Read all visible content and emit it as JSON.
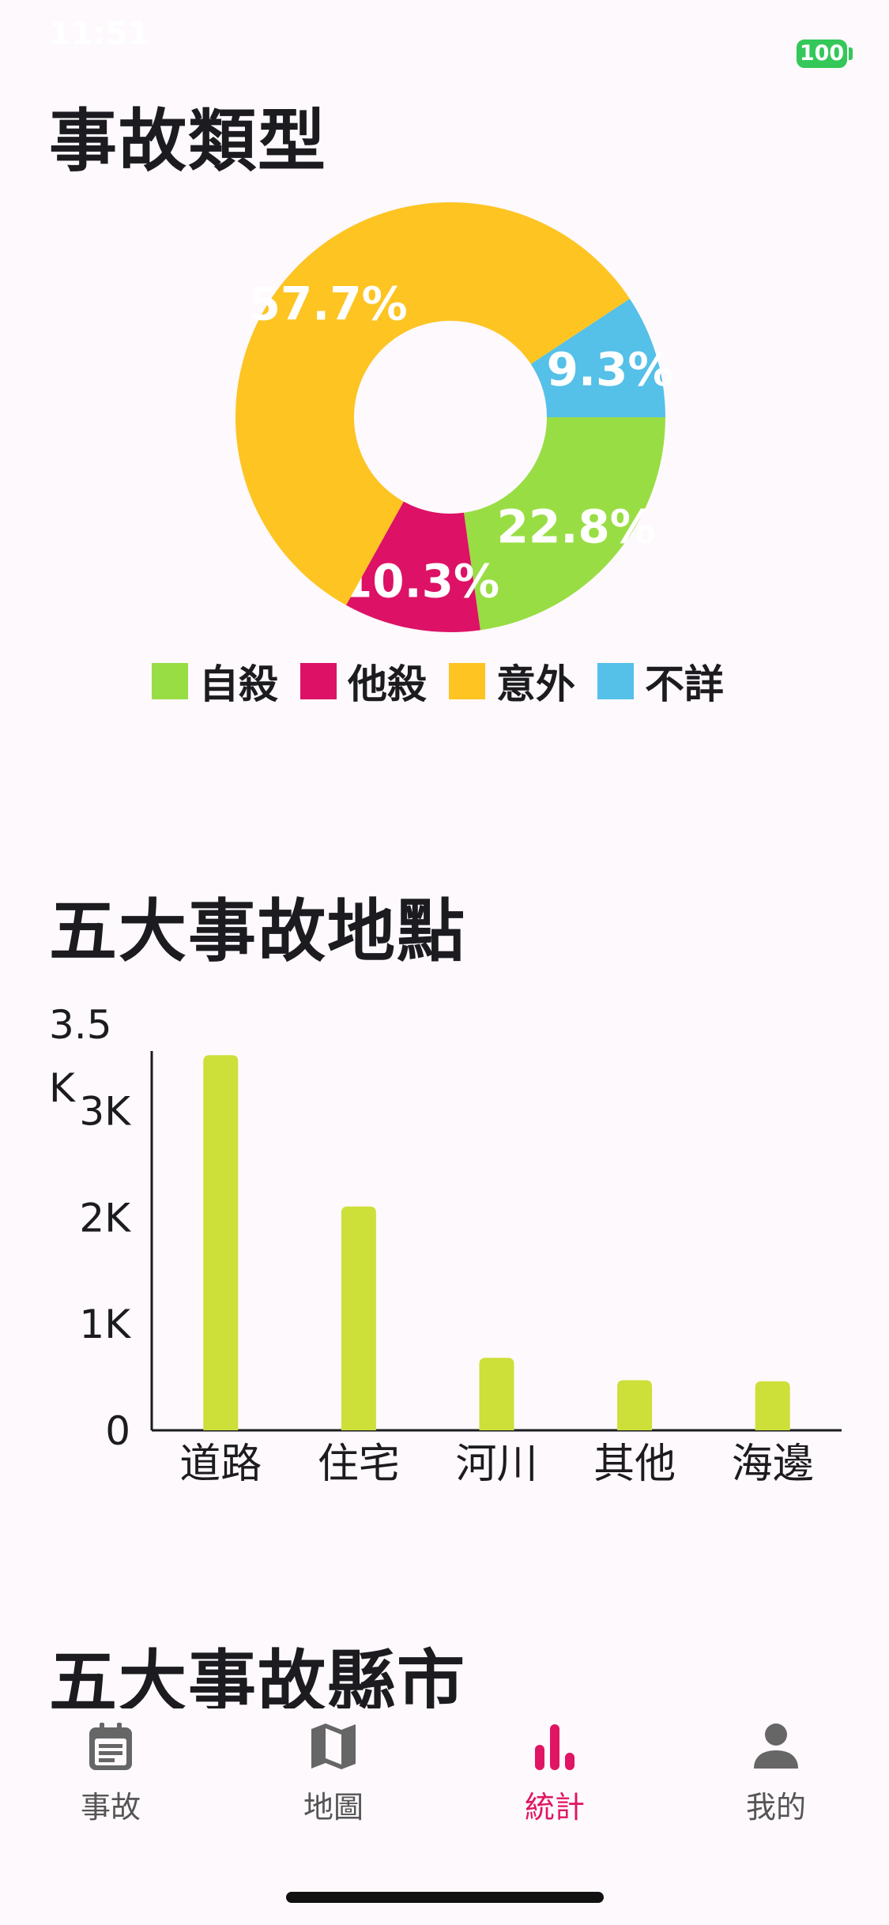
{
  "status_bar": {
    "time": "11:51",
    "battery": "100"
  },
  "sections": {
    "accident_types": "事故類型",
    "top_places": "五大事故地點",
    "top_counties": "五大事故縣市"
  },
  "tabs": [
    {
      "label": "事故",
      "icon": "calendar-icon",
      "active": false
    },
    {
      "label": "地圖",
      "icon": "map-icon",
      "active": false
    },
    {
      "label": "統計",
      "icon": "bar-chart-icon",
      "active": true
    },
    {
      "label": "我的",
      "icon": "person-icon",
      "active": false
    }
  ],
  "colors": {
    "suicide": "#99dd44",
    "homicide": "#dd1166",
    "accident": "#fdc422",
    "unknown": "#55c0e8",
    "bar": "#cddf39",
    "active_tab": "#e01563",
    "inactive_tab": "#666666"
  },
  "chart_data": [
    {
      "type": "pie",
      "title": "事故類型",
      "labels": [
        "自殺",
        "他殺",
        "意外",
        "不詳"
      ],
      "values": [
        22.8,
        10.3,
        57.7,
        9.3
      ],
      "data_labels": [
        "22.8%",
        "10.3%",
        "57.7%",
        "9.3%"
      ],
      "colors": [
        "#99dd44",
        "#dd1166",
        "#fdc422",
        "#55c0e8"
      ],
      "donut": true,
      "legend": "bottom"
    },
    {
      "type": "bar",
      "title": "五大事故地點",
      "categories": [
        "道路",
        "住宅",
        "河川",
        "其他",
        "海邊"
      ],
      "values": [
        3520,
        2100,
        680,
        470,
        460
      ],
      "ylim": [
        0,
        3500
      ],
      "yticks": [
        0,
        1000,
        2000,
        3000,
        3500
      ],
      "ytick_labels": [
        "0",
        "1K",
        "2K",
        "3K",
        "3.5 K"
      ],
      "grid": false
    }
  ]
}
